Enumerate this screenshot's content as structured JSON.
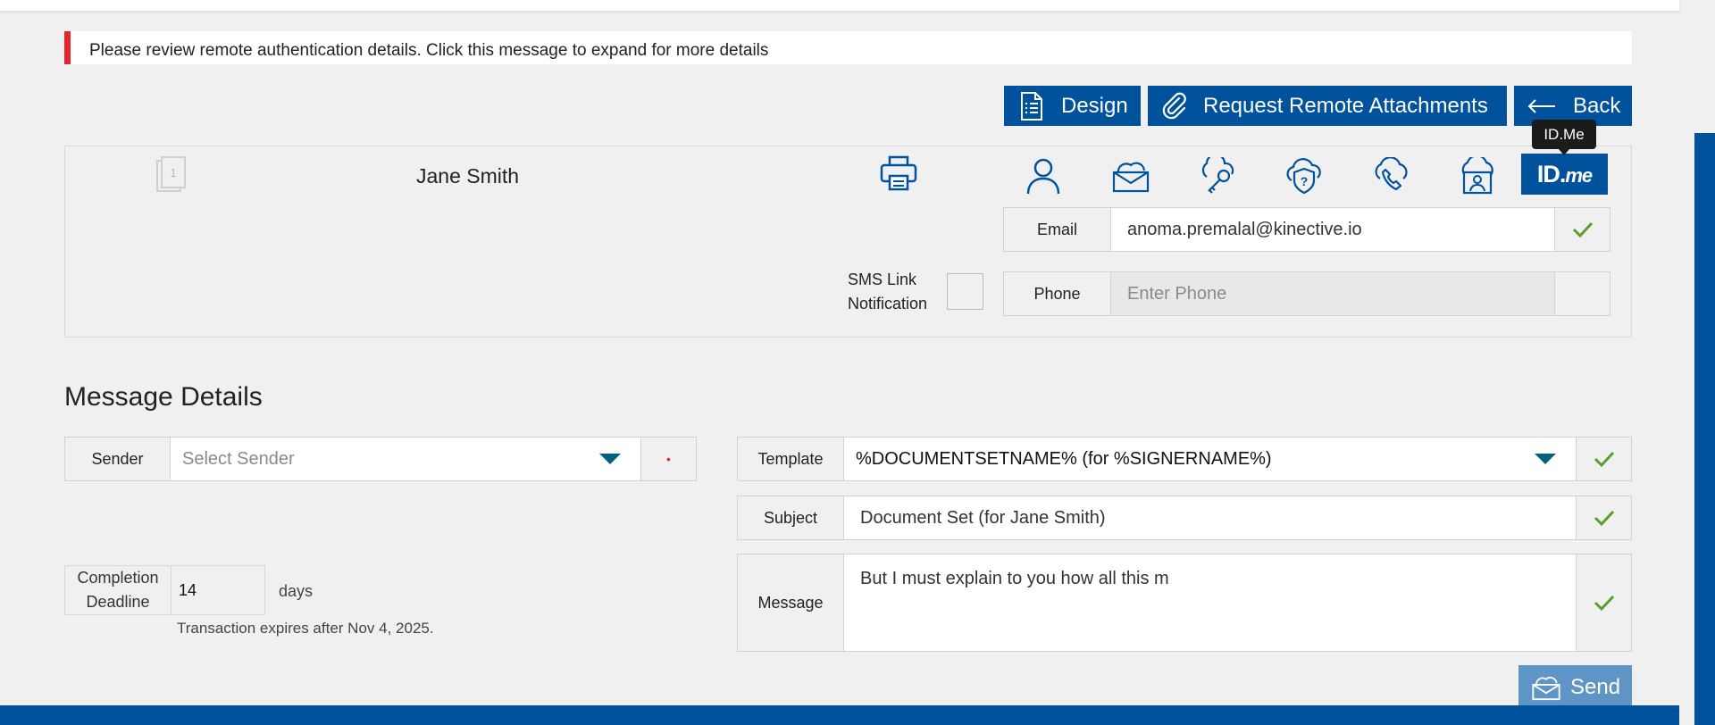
{
  "alert": {
    "message": "Please review remote authentication details. Click this message to expand for more details"
  },
  "toolbar": {
    "design_label": "Design",
    "request_attachments_label": "Request Remote Attachments",
    "back_label": "Back"
  },
  "tooltip": {
    "text": "ID.Me"
  },
  "signer": {
    "name": "Jane Smith",
    "document_count": "1",
    "auth_methods": [
      "user-icon",
      "email-cloud-icon",
      "key-cloud-icon",
      "question-shield-cloud-icon",
      "phone-cloud-icon",
      "id-card-cloud-icon",
      "idme-logo"
    ],
    "idme_logo_text": "ID.",
    "idme_logo_suffix": "me",
    "email": {
      "label": "Email",
      "value": "anoma.premalal@kinective.io",
      "status": "check-icon"
    },
    "sms": {
      "label_line1": "SMS Link",
      "label_line2": "Notification",
      "checked": false
    },
    "phone": {
      "label": "Phone",
      "placeholder": "Enter Phone",
      "value": ""
    }
  },
  "message_details": {
    "title": "Message Details",
    "sender": {
      "label": "Sender",
      "placeholder": "Select Sender",
      "required_mark": "•"
    },
    "template": {
      "label": "Template",
      "value": "%DOCUMENTSETNAME% (for %SIGNERNAME%)"
    },
    "subject": {
      "label": "Subject",
      "value": "Document Set (for Jane Smith)"
    },
    "message": {
      "label": "Message",
      "value": "But I must explain to you how all this m"
    },
    "deadline": {
      "label_line1": "Completion",
      "label_line2": "Deadline",
      "value": "14",
      "unit": "days",
      "expiry_note": "Transaction expires after Nov 4, 2025."
    },
    "send_label": "Send"
  },
  "colors": {
    "primary": "#00529c",
    "alert": "#e3262c",
    "check": "#5a9e2f",
    "caret": "#08607d",
    "send": "#5f95c6"
  }
}
